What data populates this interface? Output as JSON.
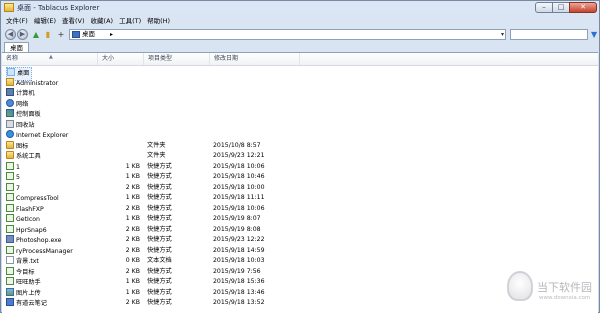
{
  "window": {
    "title": "桌面 - Tablacus Explorer",
    "min": "–",
    "max": "□",
    "close": "✕"
  },
  "menu": [
    "文件(F)",
    "编辑(E)",
    "查看(V)",
    "收藏(A)",
    "工具(T)",
    "帮助(H)"
  ],
  "toolbar": {
    "back_icon": "back-arrow-icon",
    "forward_icon": "forward-arrow-icon",
    "address": "桌面",
    "address_arrow": "▸",
    "address_dropdown": "▾",
    "filter_icon": "funnel-icon"
  },
  "tab": {
    "label": "桌面"
  },
  "columns": [
    "名称",
    "大小",
    "项目类型",
    "修改日期"
  ],
  "rows": [
    {
      "icon": "selected",
      "name": "桌面",
      "size": "",
      "type": "",
      "date": ""
    },
    {
      "icon": "user",
      "name": "Administrator",
      "size": "",
      "type": "",
      "date": ""
    },
    {
      "icon": "computer",
      "name": "计算机",
      "size": "",
      "type": "",
      "date": ""
    },
    {
      "icon": "network",
      "name": "网络",
      "size": "",
      "type": "",
      "date": ""
    },
    {
      "icon": "control",
      "name": "控制面板",
      "size": "",
      "type": "",
      "date": ""
    },
    {
      "icon": "recycle",
      "name": "回收站",
      "size": "",
      "type": "",
      "date": ""
    },
    {
      "icon": "ie",
      "name": "Internet Explorer",
      "size": "",
      "type": "",
      "date": ""
    },
    {
      "icon": "folder",
      "name": "图标",
      "size": "",
      "type": "文件夹",
      "date": "2015/10/8 8:57"
    },
    {
      "icon": "folder",
      "name": "系统工具",
      "size": "",
      "type": "文件夹",
      "date": "2015/9/23 12:21"
    },
    {
      "icon": "shortcut",
      "name": "1",
      "size": "1 KB",
      "type": "快捷方式",
      "date": "2015/9/18 10:06"
    },
    {
      "icon": "shortcut",
      "name": "5",
      "size": "1 KB",
      "type": "快捷方式",
      "date": "2015/9/18 10:46"
    },
    {
      "icon": "shortcut",
      "name": "7",
      "size": "2 KB",
      "type": "快捷方式",
      "date": "2015/9/18 10:00"
    },
    {
      "icon": "shortcut",
      "name": "CompressTool",
      "size": "1 KB",
      "type": "快捷方式",
      "date": "2015/9/18 11:11"
    },
    {
      "icon": "shortcut",
      "name": "FlashFXP",
      "size": "2 KB",
      "type": "快捷方式",
      "date": "2015/9/18 10:06"
    },
    {
      "icon": "shortcut",
      "name": "GetIcon",
      "size": "1 KB",
      "type": "快捷方式",
      "date": "2015/9/19 8:07"
    },
    {
      "icon": "shortcut",
      "name": "HprSnap6",
      "size": "2 KB",
      "type": "快捷方式",
      "date": "2015/9/19 8:08"
    },
    {
      "icon": "app",
      "name": "Photoshop.exe",
      "size": "2 KB",
      "type": "快捷方式",
      "date": "2015/9/23 12:22"
    },
    {
      "icon": "shortcut",
      "name": "ryProcessManager",
      "size": "2 KB",
      "type": "快捷方式",
      "date": "2015/9/18 14:59"
    },
    {
      "icon": "txt",
      "name": "背景.txt",
      "size": "0 KB",
      "type": "文本文档",
      "date": "2015/9/18 10:03"
    },
    {
      "icon": "shortcut",
      "name": "今目标",
      "size": "2 KB",
      "type": "快捷方式",
      "date": "2015/9/19 7:56"
    },
    {
      "icon": "shortcut",
      "name": "旺旺助手",
      "size": "1 KB",
      "type": "快捷方式",
      "date": "2015/9/18 15:36"
    },
    {
      "icon": "pic",
      "name": "图片上传",
      "size": "1 KB",
      "type": "快捷方式",
      "date": "2015/9/18 13:46"
    },
    {
      "icon": "note",
      "name": "有道云笔记",
      "size": "2 KB",
      "type": "快捷方式",
      "date": "2015/9/18 13:52"
    }
  ],
  "watermark": {
    "text": "当下软件园",
    "url": "www.downxia.com"
  }
}
